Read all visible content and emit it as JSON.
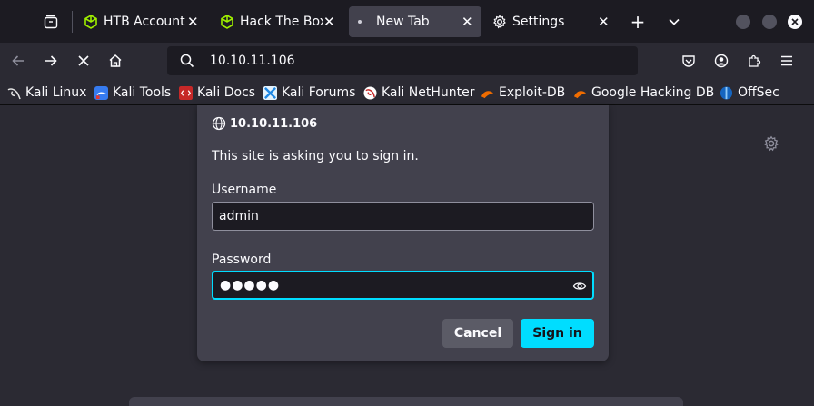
{
  "tabs": [
    {
      "title": "HTB Account",
      "icon": "hackthebox-icon"
    },
    {
      "title": "Hack The Box",
      "icon": "hackthebox-icon"
    },
    {
      "title": "New Tab",
      "icon": "loading-dot-icon"
    },
    {
      "title": "Settings",
      "icon": "gear-icon"
    }
  ],
  "urlbar": {
    "url": "10.10.11.106"
  },
  "bookmarks": [
    {
      "label": "Kali Linux",
      "icon": "kali-icon"
    },
    {
      "label": "Kali Tools",
      "icon": "kali-tools-icon"
    },
    {
      "label": "Kali Docs",
      "icon": "kali-docs-icon"
    },
    {
      "label": "Kali Forums",
      "icon": "kali-forums-icon"
    },
    {
      "label": "Kali NetHunter",
      "icon": "nethunter-icon"
    },
    {
      "label": "Exploit-DB",
      "icon": "exploit-db-icon"
    },
    {
      "label": "Google Hacking DB",
      "icon": "ghdb-icon"
    },
    {
      "label": "OffSec",
      "icon": "offsec-icon"
    }
  ],
  "dialog": {
    "host": "10.10.11.106",
    "message": "This site is asking you to sign in.",
    "username_label": "Username",
    "username_value": "admin",
    "password_label": "Password",
    "password_masked": "●●●●●",
    "cancel_label": "Cancel",
    "signin_label": "Sign in"
  },
  "colors": {
    "accent": "#00ddff",
    "htb_green": "#9fef00"
  }
}
